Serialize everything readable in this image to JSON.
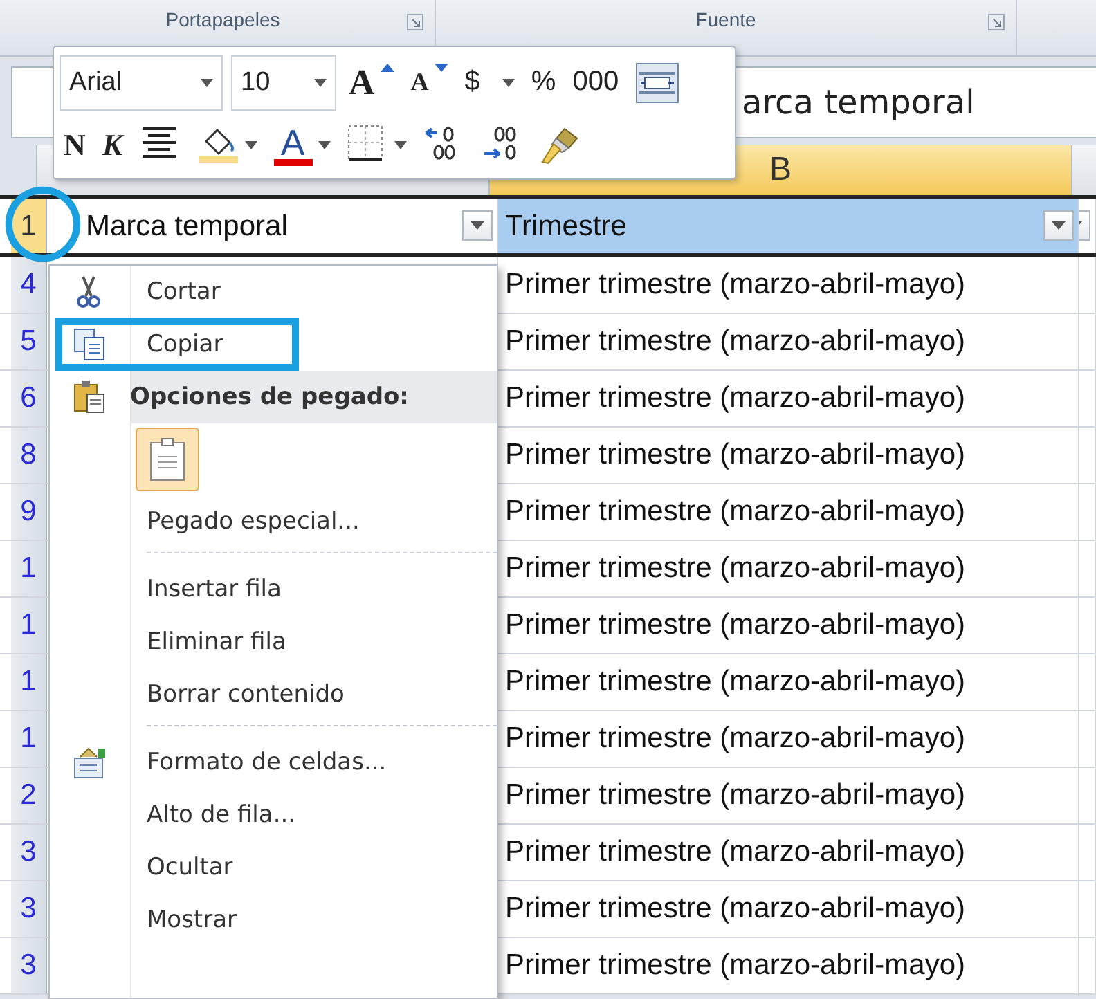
{
  "ribbon": {
    "groups": [
      {
        "label": "Portapapeles"
      },
      {
        "label": "Fuente"
      }
    ]
  },
  "formula_bar": {
    "value": "arca temporal"
  },
  "column_headers": [
    {
      "selected": false
    },
    {
      "label": "B",
      "selected": true
    },
    {
      "selected": false
    }
  ],
  "header_row": {
    "row_number": "1",
    "circled": true,
    "cells": [
      {
        "text": "Marca temporal",
        "filter": true,
        "selected": false
      },
      {
        "text": "Trimestre",
        "filter": true,
        "selected": true
      },
      {
        "filter": true,
        "selected": false
      }
    ]
  },
  "rows": [
    {
      "row_number": "4",
      "value": "Primer trimestre (marzo-abril-mayo)"
    },
    {
      "row_number": "5",
      "value": "Primer trimestre (marzo-abril-mayo)"
    },
    {
      "row_number": "6",
      "value": "Primer trimestre (marzo-abril-mayo)"
    },
    {
      "row_number": "8",
      "value": "Primer trimestre (marzo-abril-mayo)"
    },
    {
      "row_number": "9",
      "value": "Primer trimestre (marzo-abril-mayo)"
    },
    {
      "row_number": "1",
      "value": "Primer trimestre (marzo-abril-mayo)"
    },
    {
      "row_number": "1",
      "value": "Primer trimestre (marzo-abril-mayo)"
    },
    {
      "row_number": "1",
      "value": "Primer trimestre (marzo-abril-mayo)"
    },
    {
      "row_number": "1",
      "value": "Primer trimestre (marzo-abril-mayo)"
    },
    {
      "row_number": "2",
      "value": "Primer trimestre (marzo-abril-mayo)"
    },
    {
      "row_number": "3",
      "value": "Primer trimestre (marzo-abril-mayo)"
    },
    {
      "row_number": "3",
      "value": "Primer trimestre (marzo-abril-mayo)"
    },
    {
      "row_number": "3",
      "value": "Primer trimestre (marzo-abril-mayo)"
    }
  ],
  "mini_toolbar": {
    "font_row": [
      {
        "kind": "font_field",
        "value": "Arial"
      },
      {
        "kind": "size_field",
        "value": "10"
      },
      {
        "kind": "grow_font",
        "label": "A"
      },
      {
        "kind": "shrink_font",
        "label": "A"
      },
      {
        "kind": "text",
        "label": "$",
        "dropdown": true
      },
      {
        "kind": "text",
        "label": "%"
      },
      {
        "kind": "text",
        "label": "000"
      },
      {
        "kind": "wrap"
      }
    ],
    "format_row": [
      {
        "kind": "bold",
        "label": "N"
      },
      {
        "kind": "italic",
        "label": "K"
      },
      {
        "kind": "align_center"
      },
      {
        "kind": "fill_color",
        "dropdown": true
      },
      {
        "kind": "font_color",
        "label": "A",
        "dropdown": true
      },
      {
        "kind": "borders",
        "dropdown": true
      },
      {
        "kind": "increase_decimal"
      },
      {
        "kind": "decrease_decimal"
      },
      {
        "kind": "format_painter"
      }
    ]
  },
  "context_menu": {
    "items": [
      {
        "kind": "item",
        "label": "Cortar",
        "highlighted": false
      },
      {
        "kind": "item",
        "label": "Copiar",
        "highlighted": true
      },
      {
        "kind": "heading",
        "label": "Opciones de pegado:"
      },
      {
        "kind": "paste_options"
      },
      {
        "kind": "item",
        "label": "Pegado especial...",
        "highlighted": false
      },
      {
        "kind": "separator"
      },
      {
        "kind": "item",
        "label": "Insertar fila",
        "highlighted": false
      },
      {
        "kind": "item",
        "label": "Eliminar fila",
        "highlighted": false
      },
      {
        "kind": "item",
        "label": "Borrar contenido",
        "highlighted": false
      },
      {
        "kind": "separator"
      },
      {
        "kind": "item",
        "label": "Formato de celdas...",
        "highlighted": false
      },
      {
        "kind": "item",
        "label": "Alto de fila...",
        "highlighted": false
      },
      {
        "kind": "item",
        "label": "Ocultar",
        "highlighted": false
      },
      {
        "kind": "item",
        "label": "Mostrar",
        "highlighted": false
      }
    ]
  }
}
